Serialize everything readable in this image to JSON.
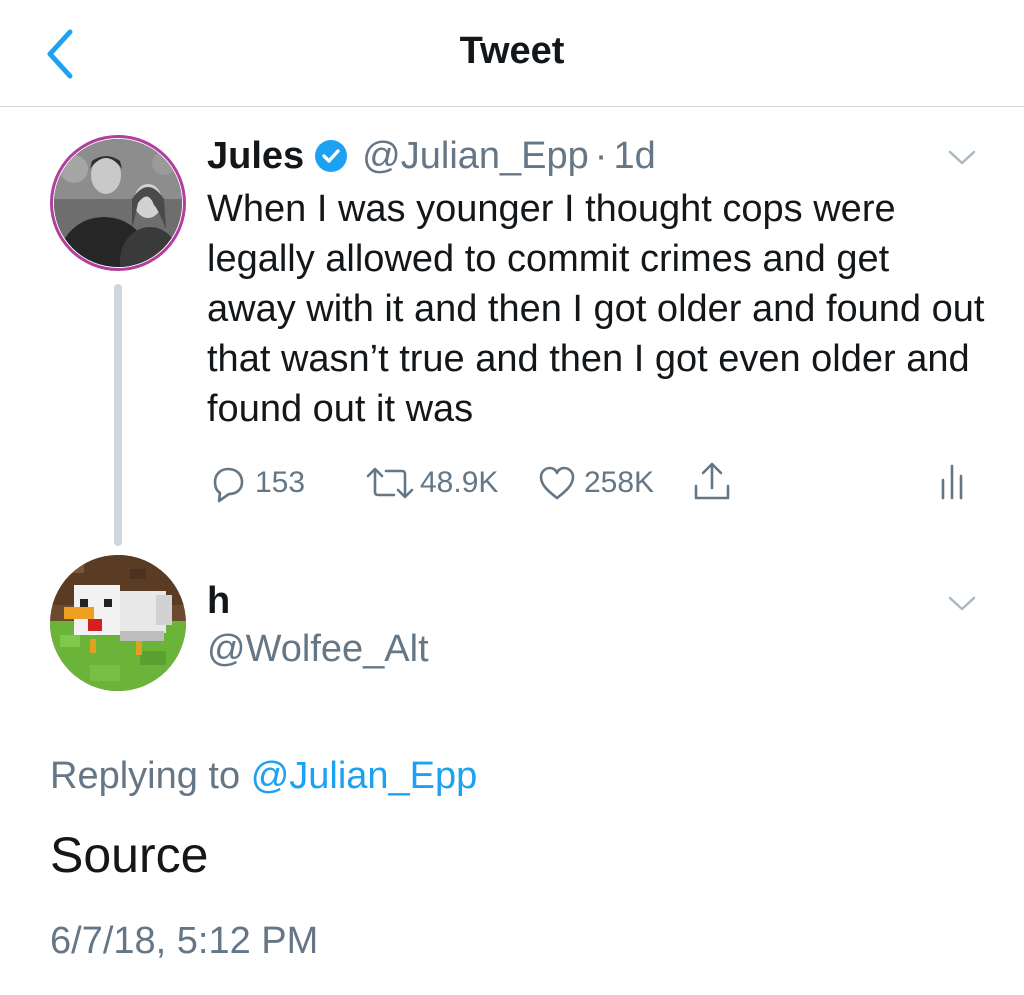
{
  "header": {
    "title": "Tweet",
    "back_icon": "chevron-left-icon"
  },
  "colors": {
    "accent": "#1da1f2",
    "muted": "#657786",
    "text": "#14171a",
    "divider": "#d3d8dc"
  },
  "original_tweet": {
    "display_name": "Jules",
    "verified": true,
    "handle": "@Julian_Epp",
    "separator": "·",
    "age": "1d",
    "text": "When I was younger I thought cops were legally allowed to commit crimes and get away with it and then I got older and found out that wasn’t true and then I got even older and found out it was",
    "actions": {
      "replies": "153",
      "retweets": "48.9K",
      "likes": "258K"
    }
  },
  "reply_tweet": {
    "display_name": "h",
    "handle": "@Wolfee_Alt",
    "replying_prefix": "Replying to",
    "replying_to": "@Julian_Epp",
    "text": "Source",
    "timestamp": "6/7/18, 5:12 PM"
  }
}
